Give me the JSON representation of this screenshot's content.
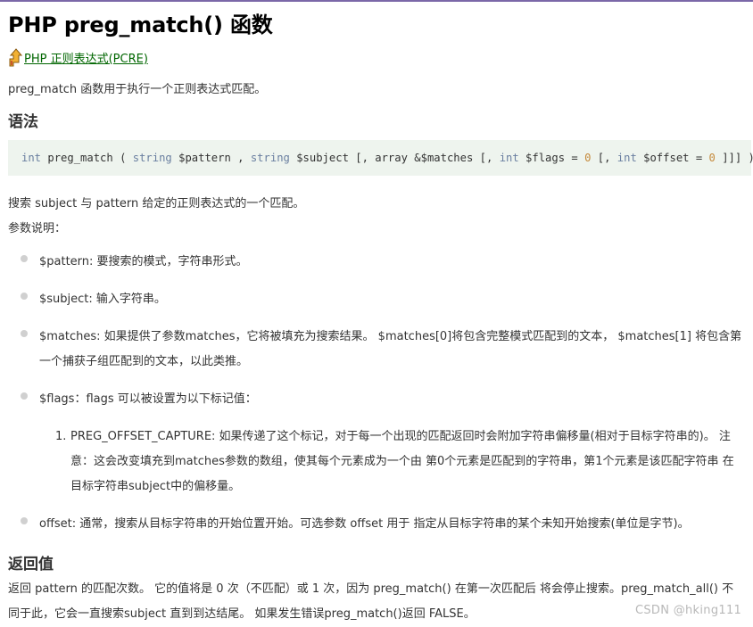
{
  "title": "PHP preg_match() 函数",
  "breadcrumb": {
    "link_text": "PHP 正则表达式(PCRE)",
    "icon": "up-arrow-icon"
  },
  "intro": "preg_match 函数用于执行一个正则表达式匹配。",
  "syntax": {
    "heading": "语法",
    "code_parts": [
      {
        "t": "kw",
        "v": "int"
      },
      {
        "t": "tx",
        "v": " preg_match ( "
      },
      {
        "t": "kw",
        "v": "string"
      },
      {
        "t": "tx",
        "v": " $pattern , "
      },
      {
        "t": "kw",
        "v": "string"
      },
      {
        "t": "tx",
        "v": " $subject [, array &$matches [, "
      },
      {
        "t": "kw",
        "v": "int"
      },
      {
        "t": "tx",
        "v": " $flags = "
      },
      {
        "t": "num",
        "v": "0"
      },
      {
        "t": "tx",
        "v": " [, "
      },
      {
        "t": "kw",
        "v": "int"
      },
      {
        "t": "tx",
        "v": " $offset = "
      },
      {
        "t": "num",
        "v": "0"
      },
      {
        "t": "tx",
        "v": " ]]] )"
      }
    ]
  },
  "description": "搜索 subject 与 pattern 给定的正则表达式的一个匹配。",
  "params_label": "参数说明：",
  "params": [
    "$pattern: 要搜索的模式，字符串形式。",
    "$subject: 输入字符串。",
    "$matches: 如果提供了参数matches，它将被填充为搜索结果。 $matches[0]将包含完整模式匹配到的文本， $matches[1] 将包含第一个捕获子组匹配到的文本，以此类推。",
    "$flags：flags 可以被设置为以下标记值：",
    "offset: 通常，搜索从目标字符串的开始位置开始。可选参数 offset 用于 指定从目标字符串的某个未知开始搜索(单位是字节)。"
  ],
  "flags_list": {
    "number": "1.",
    "text": "PREG_OFFSET_CAPTURE: 如果传递了这个标记，对于每一个出现的匹配返回时会附加字符串偏移量(相对于目标字符串的)。 注意：这会改变填充到matches参数的数组，使其每个元素成为一个由 第0个元素是匹配到的字符串，第1个元素是该匹配字符串 在目标字符串subject中的偏移量。"
  },
  "return": {
    "heading": "返回值",
    "text": "返回 pattern 的匹配次数。 它的值将是 0 次（不匹配）或 1 次，因为 preg_match() 在第一次匹配后 将会停止搜索。preg_match_all() 不同于此，它会一直搜索subject 直到到达结尾。 如果发生错误preg_match()返回 FALSE。"
  },
  "watermark": "CSDN @hking111",
  "colors": {
    "link": "#006600",
    "code_bg": "#EEF4EE",
    "keyword": "#6A7FA0",
    "number": "#C58A3C"
  }
}
